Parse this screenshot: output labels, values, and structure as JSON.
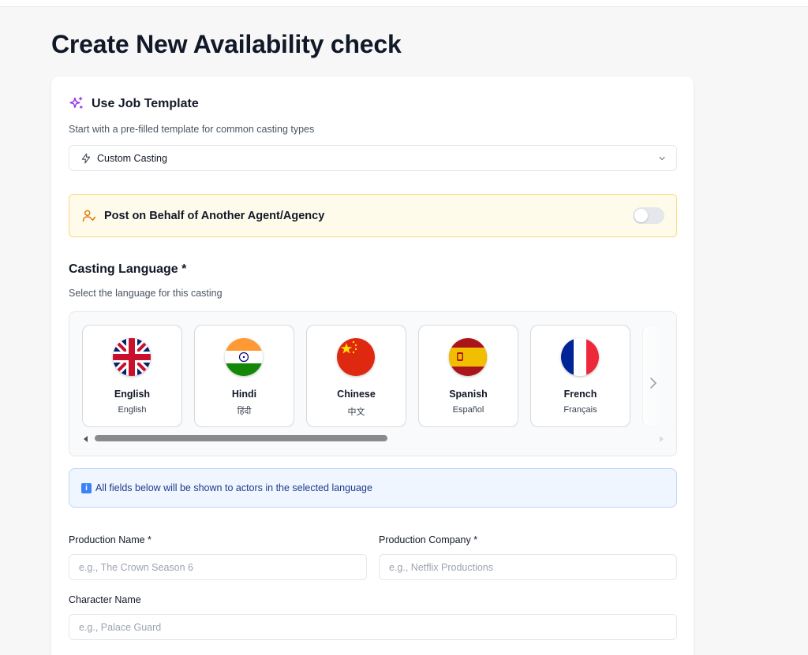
{
  "page": {
    "title": "Create New Availability check"
  },
  "template": {
    "title": "Use Job Template",
    "subtitle": "Start with a pre-filled template for common casting types",
    "selected": "Custom Casting"
  },
  "behalf": {
    "label": "Post on Behalf of Another Agent/Agency",
    "enabled": false
  },
  "language": {
    "title": "Casting Language *",
    "subtitle": "Select the language for this casting",
    "options": [
      {
        "name": "English",
        "native": "English",
        "flag": "uk-flag-icon"
      },
      {
        "name": "Hindi",
        "native": "हिंदी",
        "flag": "india-flag-icon"
      },
      {
        "name": "Chinese",
        "native": "中文",
        "flag": "china-flag-icon"
      },
      {
        "name": "Spanish",
        "native": "Español",
        "flag": "spain-flag-icon"
      },
      {
        "name": "French",
        "native": "Français",
        "flag": "france-flag-icon"
      }
    ]
  },
  "info": {
    "text": "All fields below will be shown to actors in the selected language"
  },
  "form": {
    "production_name": {
      "label": "Production Name *",
      "placeholder": "e.g., The Crown Season 6"
    },
    "production_company": {
      "label": "Production Company *",
      "placeholder": "e.g., Netflix Productions"
    },
    "character_name": {
      "label": "Character Name",
      "placeholder": "e.g., Palace Guard"
    }
  },
  "colors": {
    "accent_purple": "#9333ea",
    "warning_bg": "#fffbeb",
    "warning_border": "#fcd77f",
    "info_bg": "#eff6ff",
    "info_border": "#bcd6f4"
  }
}
